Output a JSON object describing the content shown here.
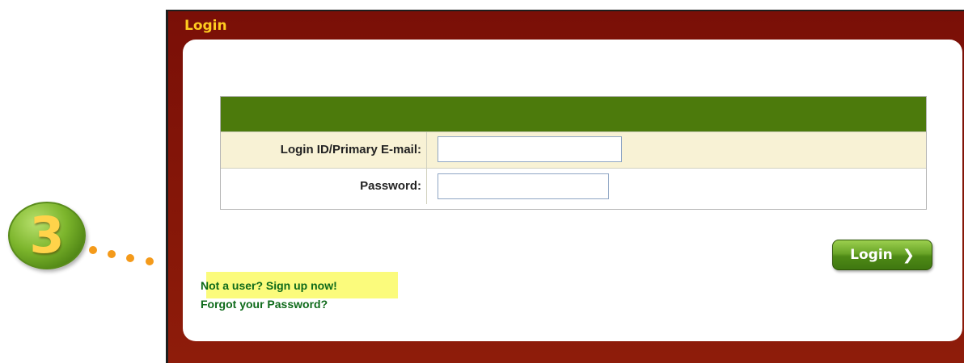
{
  "panel": {
    "title": "Login"
  },
  "form": {
    "email_label": "Login ID/Primary E-mail:",
    "email_value": "",
    "password_label": "Password:",
    "password_value": ""
  },
  "actions": {
    "login_label": "Login",
    "login_chevron": "❯",
    "signup_link": "Not a user? Sign up now!",
    "forgot_link": "Forgot your Password?"
  },
  "annotation": {
    "step_number": "3",
    "color": "#f49a1a",
    "badge_color": "#6aa528"
  },
  "colors": {
    "panel_background": "#7a0f07",
    "title_color": "#ffcc1f",
    "form_header": "#4c7a0c",
    "row_shading": "#f8f2d5",
    "link_color": "#0e6a1a",
    "highlight": "#fbfb7c"
  }
}
